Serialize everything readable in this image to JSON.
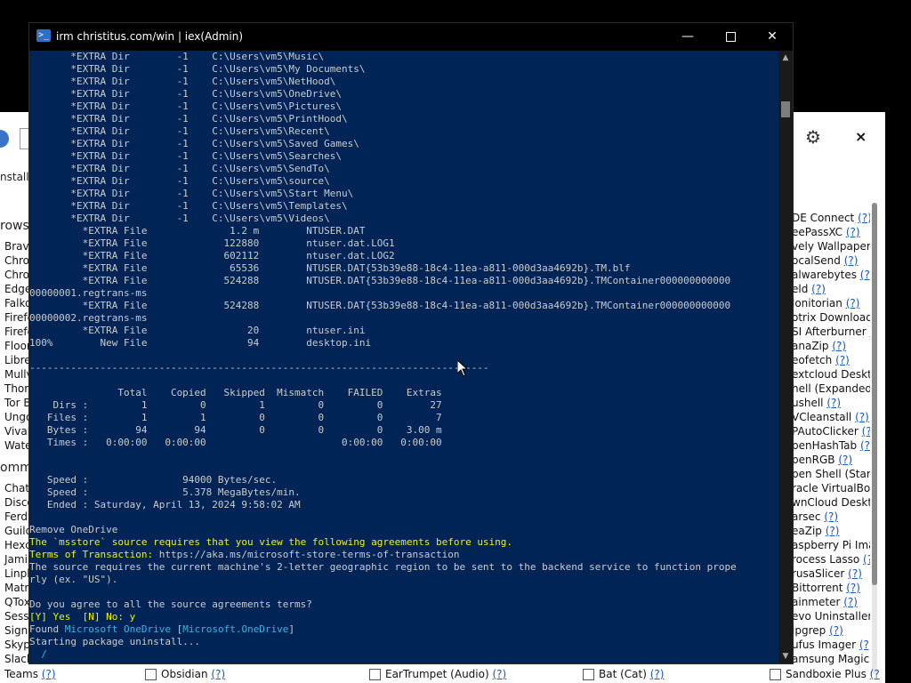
{
  "background_app": {
    "install_text": "nstall/",
    "gear_icon": "gear-icon",
    "close_label": "×",
    "section_browsers": "rows",
    "section_communications": "omm",
    "left_list": [
      "Brave",
      "Chron",
      "Chron",
      "Edge",
      "Falko",
      "Firefc",
      "Firefc",
      "Floor",
      "Libre\\",
      "Mullv",
      "Thori",
      "Tor B",
      "Ungo",
      "Vivalc",
      "Wate"
    ],
    "left_list2": [
      "Chatt",
      "Disco",
      "Ferdi",
      "Guild",
      "Hexc",
      "Jami",
      "Linph",
      "Matri",
      "QTox",
      "Sessi",
      "Signa",
      "Skype",
      "Slack"
    ],
    "teams_label": "Teams",
    "q": "(?)",
    "right_list": [
      {
        "label": "DE Connect",
        "q": "(?)"
      },
      {
        "label": "eePassXC",
        "q": "(?)"
      },
      {
        "label": "vely Wallpaper",
        "q": "("
      },
      {
        "label": "ocalSend",
        "q": "(?)"
      },
      {
        "label": "alwarebytes",
        "q": "(?)"
      },
      {
        "label": "eld",
        "q": "(?)"
      },
      {
        "label": "lonitorian",
        "q": "(?)"
      },
      {
        "label": "otrix Download",
        "q": ""
      },
      {
        "label": "SI Afterburner",
        "q": "("
      },
      {
        "label": "anaZip",
        "q": "(?)"
      },
      {
        "label": "eofetch",
        "q": "(?)"
      },
      {
        "label": "extcloud Deskto",
        "q": ""
      },
      {
        "label": "hell (Expanded C",
        "q": ""
      },
      {
        "label": "ushell",
        "q": "(?)"
      },
      {
        "label": "VCleanstall",
        "q": "(?)"
      },
      {
        "label": "PAutoClicker",
        "q": "(?)"
      },
      {
        "label": "penHashTab",
        "q": "(?)"
      },
      {
        "label": "penRGB",
        "q": "(?)"
      },
      {
        "label": "pen Shell (Start",
        "q": ""
      },
      {
        "label": "racle VirtualBox",
        "q": ""
      },
      {
        "label": "wnCloud Deskto",
        "q": ""
      },
      {
        "label": "arsec",
        "q": "(?)"
      },
      {
        "label": "eaZip",
        "q": "(?)"
      },
      {
        "label": "aspberry Pi Imag",
        "q": ""
      },
      {
        "label": "rocess Lasso",
        "q": "(?)"
      },
      {
        "label": "rusaSlicer",
        "q": "(?)"
      },
      {
        "label": "Bittorrent",
        "q": "(?)"
      },
      {
        "label": "ainmeter",
        "q": "(?)"
      },
      {
        "label": "evo Uninstaller",
        "q": "("
      },
      {
        "label": "ipgrep",
        "q": "(?)"
      },
      {
        "label": "ufus Imager",
        "q": "(?)"
      },
      {
        "label": "amsung Magicia",
        "q": ""
      }
    ],
    "bottom_items": [
      {
        "label": "Obsidian",
        "q": "(?)"
      },
      {
        "label": "EarTrumpet (Audio)",
        "q": "(?)"
      },
      {
        "label": "Bat (Cat)",
        "q": "(?)"
      },
      {
        "label": "Sandboxie Plus",
        "q": "(?"
      }
    ]
  },
  "terminal": {
    "title": "irm christitus.com/win | iex(Admin)",
    "icon": "powershell-icon",
    "min_label": "—",
    "close_label": "✕",
    "lines": [
      {
        "text": "       *EXTRA Dir        -1    C:\\Users\\vm5\\Music\\",
        "color": ""
      },
      {
        "text": "       *EXTRA Dir        -1    C:\\Users\\vm5\\My Documents\\",
        "color": ""
      },
      {
        "text": "       *EXTRA Dir        -1    C:\\Users\\vm5\\NetHood\\",
        "color": ""
      },
      {
        "text": "       *EXTRA Dir        -1    C:\\Users\\vm5\\OneDrive\\",
        "color": ""
      },
      {
        "text": "       *EXTRA Dir        -1    C:\\Users\\vm5\\Pictures\\",
        "color": ""
      },
      {
        "text": "       *EXTRA Dir        -1    C:\\Users\\vm5\\PrintHood\\",
        "color": ""
      },
      {
        "text": "       *EXTRA Dir        -1    C:\\Users\\vm5\\Recent\\",
        "color": ""
      },
      {
        "text": "       *EXTRA Dir        -1    C:\\Users\\vm5\\Saved Games\\",
        "color": ""
      },
      {
        "text": "       *EXTRA Dir        -1    C:\\Users\\vm5\\Searches\\",
        "color": ""
      },
      {
        "text": "       *EXTRA Dir        -1    C:\\Users\\vm5\\SendTo\\",
        "color": ""
      },
      {
        "text": "       *EXTRA Dir        -1    C:\\Users\\vm5\\source\\",
        "color": ""
      },
      {
        "text": "       *EXTRA Dir        -1    C:\\Users\\vm5\\Start Menu\\",
        "color": ""
      },
      {
        "text": "       *EXTRA Dir        -1    C:\\Users\\vm5\\Templates\\",
        "color": ""
      },
      {
        "text": "       *EXTRA Dir        -1    C:\\Users\\vm5\\Videos\\",
        "color": ""
      },
      {
        "text": "         *EXTRA File              1.2 m        NTUSER.DAT",
        "color": ""
      },
      {
        "text": "         *EXTRA File             122880        ntuser.dat.LOG1",
        "color": ""
      },
      {
        "text": "         *EXTRA File             602112        ntuser.dat.LOG2",
        "color": ""
      },
      {
        "text": "         *EXTRA File              65536        NTUSER.DAT{53b39e88-18c4-11ea-a811-000d3aa4692b}.TM.blf",
        "color": ""
      },
      {
        "text": "         *EXTRA File             524288        NTUSER.DAT{53b39e88-18c4-11ea-a811-000d3aa4692b}.TMContainer000000000000",
        "color": ""
      },
      {
        "text": "00000001.regtrans-ms",
        "color": ""
      },
      {
        "text": "         *EXTRA File             524288        NTUSER.DAT{53b39e88-18c4-11ea-a811-000d3aa4692b}.TMContainer000000000000",
        "color": ""
      },
      {
        "text": "00000002.regtrans-ms",
        "color": ""
      },
      {
        "text": "         *EXTRA File                 20        ntuser.ini",
        "color": ""
      },
      {
        "text": "100%        New File                 94        desktop.ini",
        "color": ""
      },
      {
        "text": "",
        "color": ""
      },
      {
        "text": "------------------------------------------------------------------------------",
        "color": ""
      },
      {
        "text": "",
        "color": ""
      },
      {
        "text": "               Total    Copied   Skipped  Mismatch    FAILED    Extras",
        "color": ""
      },
      {
        "text": "    Dirs :         1         0         1         0         0        27",
        "color": ""
      },
      {
        "text": "   Files :         1         1         0         0         0         7",
        "color": ""
      },
      {
        "text": "   Bytes :        94        94         0         0         0    3.00 m",
        "color": ""
      },
      {
        "text": "   Times :   0:00:00   0:00:00                       0:00:00   0:00:00",
        "color": ""
      },
      {
        "text": "",
        "color": ""
      },
      {
        "text": "",
        "color": ""
      },
      {
        "text": "   Speed :                94000 Bytes/sec.",
        "color": ""
      },
      {
        "text": "   Speed :                5.378 MegaBytes/min.",
        "color": ""
      },
      {
        "text": "   Ended : Saturday, April 13, 2024 9:58:02 AM",
        "color": ""
      },
      {
        "text": "",
        "color": ""
      },
      {
        "text": "Remove OneDrive",
        "color": ""
      },
      {
        "text": "The `msstore` source requires that you view the following agreements before using.",
        "color": "y"
      },
      {
        "text": "Terms of Transaction: https://aka.ms/microsoft-store-terms-of-transaction",
        "color": "mixed_terms"
      },
      {
        "text": "The source requires the current machine's 2-letter geographic region to be sent to the backend service to function prope",
        "color": ""
      },
      {
        "text": "rly (ex. \"US\").",
        "color": ""
      },
      {
        "text": "",
        "color": ""
      },
      {
        "text": "Do you agree to all the source agreements terms?",
        "color": ""
      },
      {
        "text": "[Y] Yes  [N] No: y",
        "color": "mixed_yn"
      },
      {
        "text": "Found Microsoft OneDrive [Microsoft.OneDrive]",
        "color": "mixed_found"
      },
      {
        "text": "Starting package uninstall...",
        "color": ""
      },
      {
        "text": "  /",
        "color": "c"
      }
    ],
    "terms_label": "Terms of Transaction:",
    "terms_url": " https://aka.ms/microsoft-store-terms-of-transaction",
    "yn_prompt": "[Y] Yes  [N] No:",
    "yn_answer": " y",
    "found_prefix": "Found ",
    "found_name": "Microsoft OneDrive",
    "found_bracket_open": " [",
    "found_id": "Microsoft.OneDrive",
    "found_bracket_close": "]"
  }
}
